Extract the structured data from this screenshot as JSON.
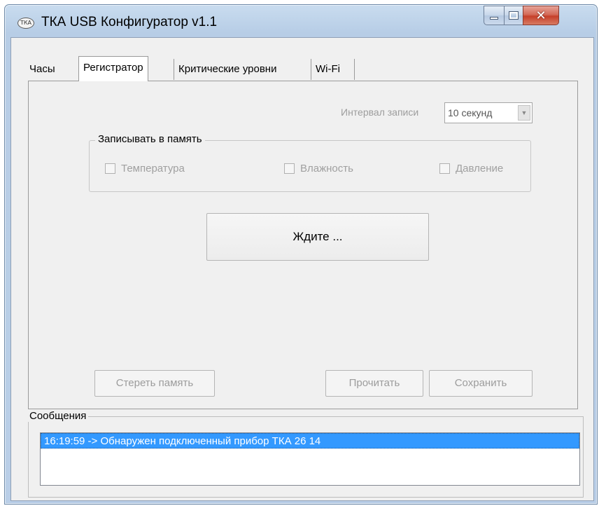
{
  "window": {
    "title": "ТКА USB Конфигуратор v1.1",
    "icon_text": "ТКА"
  },
  "tabs": [
    {
      "label": "Часы",
      "selected": false
    },
    {
      "label": "Регистратор",
      "selected": true
    },
    {
      "label": "Критические уровни",
      "selected": false
    },
    {
      "label": "Wi-Fi",
      "selected": false
    }
  ],
  "logger": {
    "interval_label": "Интервал записи",
    "interval_value": "10 секунд",
    "group_title": "Записывать в память",
    "checkboxes": [
      {
        "label": "Температура",
        "checked": false,
        "enabled": false
      },
      {
        "label": "Влажность",
        "checked": false,
        "enabled": false
      },
      {
        "label": "Давление",
        "checked": false,
        "enabled": false
      }
    ],
    "wait_button": "Ждите ...",
    "erase_button": "Стереть память",
    "read_button": "Прочитать",
    "save_button": "Сохранить"
  },
  "messages": {
    "title": "Сообщения",
    "items": [
      "16:19:59 -> Обнаружен подключенный прибор ТКА 26 14"
    ]
  },
  "icons": {
    "minimize": "minimize-icon",
    "maximize": "maximize-icon",
    "close": "close-icon",
    "dropdown": "chevron-down-icon"
  },
  "colors": {
    "selection": "#3399ff",
    "close_button": "#c6402a",
    "disabled_text": "#a0a0a0"
  }
}
